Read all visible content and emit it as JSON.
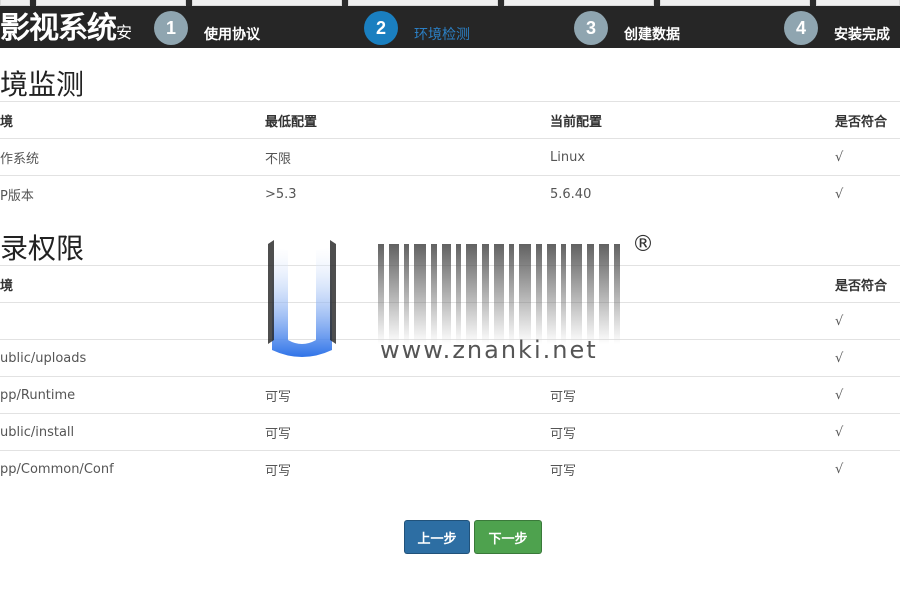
{
  "header": {
    "brand": "影视系统",
    "brand_suffix": "安",
    "steps": [
      {
        "num": "1",
        "label": "使用协议"
      },
      {
        "num": "2",
        "label": "环境检测"
      },
      {
        "num": "3",
        "label": "创建数据"
      },
      {
        "num": "4",
        "label": "安装完成"
      }
    ]
  },
  "env_section": {
    "title": "境监测",
    "headers": [
      "境",
      "最低配置",
      "当前配置",
      "是否符合"
    ],
    "rows": [
      [
        "作系统",
        "不限",
        "Linux",
        "√"
      ],
      [
        "P版本",
        ">5.3",
        "5.6.40",
        "√"
      ]
    ]
  },
  "dir_section": {
    "title": "录权限",
    "headers": [
      "境",
      "",
      "",
      "是否符合"
    ],
    "rows": [
      [
        "",
        "",
        "",
        "√"
      ],
      [
        "ublic/uploads",
        "",
        "",
        "√"
      ],
      [
        "pp/Runtime",
        "可写",
        "可写",
        "√"
      ],
      [
        "ublic/install",
        "可写",
        "可写",
        "√"
      ],
      [
        "pp/Common/Conf",
        "可写",
        "可写",
        "√"
      ]
    ]
  },
  "buttons": {
    "prev": "上一步",
    "next": "下一步"
  },
  "watermark": {
    "text": "www.znanki.net",
    "mark": "®"
  }
}
